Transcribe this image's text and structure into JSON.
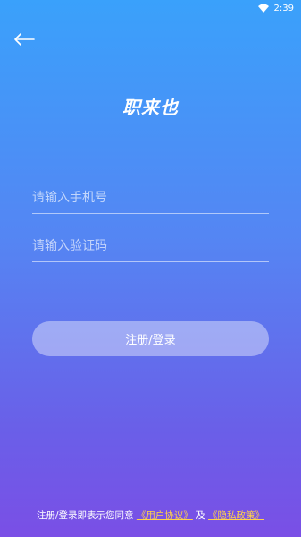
{
  "status_bar": {
    "time": "2:39",
    "wifi_icon": "wifi-icon"
  },
  "header": {
    "back_icon": "arrow-left-icon",
    "title": "职来也"
  },
  "form": {
    "phone_placeholder": "请输入手机号",
    "code_placeholder": "请输入验证码",
    "submit_label": "注册/登录"
  },
  "agreement": {
    "prefix": "注册/登录即表示您同意",
    "user_agreement": "《用户协议》",
    "conjunction": "及",
    "privacy_policy": "《隐私政策》"
  },
  "colors": {
    "gradient_top": "#3aa1fb",
    "gradient_bottom": "#7a4fe6",
    "link": "#ffd24a"
  }
}
